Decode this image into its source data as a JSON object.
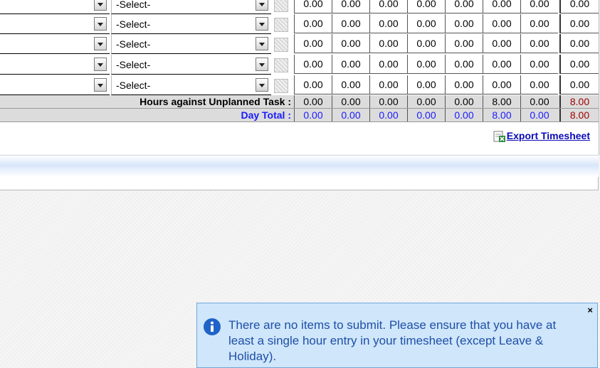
{
  "rows": [
    {
      "task": "-Select-",
      "hours": [
        "0.00",
        "0.00",
        "0.00",
        "0.00",
        "0.00",
        "0.00",
        "0.00",
        "0.00"
      ]
    },
    {
      "task": "-Select-",
      "hours": [
        "0.00",
        "0.00",
        "0.00",
        "0.00",
        "0.00",
        "0.00",
        "0.00",
        "0.00"
      ]
    },
    {
      "task": "-Select-",
      "hours": [
        "0.00",
        "0.00",
        "0.00",
        "0.00",
        "0.00",
        "0.00",
        "0.00",
        "0.00"
      ]
    },
    {
      "task": "-Select-",
      "hours": [
        "0.00",
        "0.00",
        "0.00",
        "0.00",
        "0.00",
        "0.00",
        "0.00",
        "0.00"
      ]
    },
    {
      "task": "-Select-",
      "hours": [
        "0.00",
        "0.00",
        "0.00",
        "0.00",
        "0.00",
        "0.00",
        "0.00",
        "0.00"
      ]
    }
  ],
  "unplanned": {
    "label": "Hours against Unplanned Task :",
    "values": [
      "0.00",
      "0.00",
      "0.00",
      "0.00",
      "0.00",
      "8.00",
      "0.00",
      "8.00"
    ]
  },
  "day_total": {
    "label": "Day Total :",
    "values": [
      "0.00",
      "0.00",
      "0.00",
      "0.00",
      "0.00",
      "8.00",
      "0.00",
      "8.00"
    ]
  },
  "export_label": "Export Timesheet",
  "notice": {
    "message": "There are no items to submit. Please ensure that you have at least a single hour entry in your timesheet (except Leave & Holiday).",
    "close_symbol": "×"
  },
  "colors": {
    "total_blue": "#1a1aff",
    "grand_total_red": "#a00000",
    "notice_bg": "#cfe6fb",
    "notice_text": "#1f4fa6"
  },
  "icons": {
    "dropdown": "chevron-down-icon",
    "toggle": "row-toggle-icon",
    "export": "excel-export-icon",
    "info": "info-icon",
    "close": "close-icon"
  }
}
